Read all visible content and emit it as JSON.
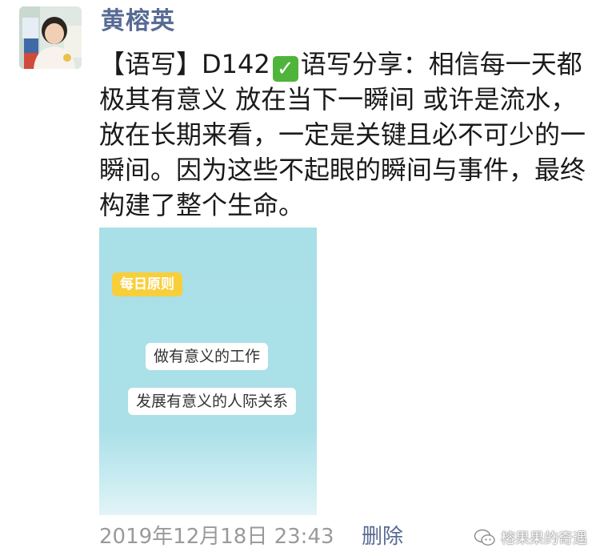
{
  "post": {
    "author": "黄榕英",
    "text_prefix": "【语写】D142",
    "check_icon": "check-mark-icon",
    "text_body": "语写分享：相信每一天都极其有意义 放在当下一瞬间 或许是流水，放在长期来看，一定是关键且必不可少的一瞬间。因为这些不起眼的瞬间与事件，最终构建了整个生命。",
    "image": {
      "tag": "每日原则",
      "line1": "做有意义的工作",
      "line2": "发展有意义的人际关系"
    },
    "timestamp": "2019年12月18日 23:43",
    "delete_label": "删除"
  },
  "watermark": {
    "icon": "wechat-official-account-icon",
    "text": "榕果果的奇遇"
  },
  "colors": {
    "author": "#586b94",
    "check": "#4fb43b",
    "image_bg": "#abe0e8",
    "tag_bg": "#f8cf3a"
  }
}
